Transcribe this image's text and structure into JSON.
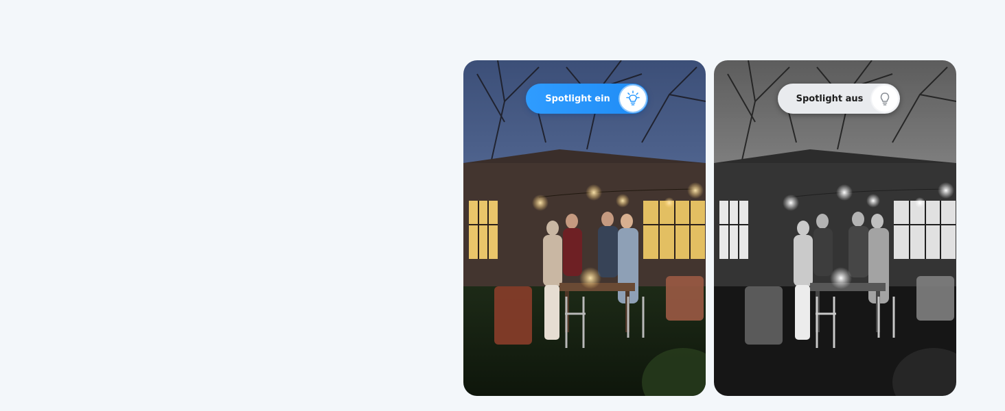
{
  "panels": [
    {
      "id": "spotlight-on",
      "toggle_label": "Spotlight ein",
      "icon": "lightbulb-on-icon",
      "state": "on",
      "image": "outdoor-dinner-party-color"
    },
    {
      "id": "spotlight-off",
      "toggle_label": "Spotlight aus",
      "icon": "lightbulb-off-icon",
      "state": "off",
      "image": "outdoor-dinner-party-grayscale"
    }
  ],
  "colors": {
    "background": "#f3f7fa",
    "toggle_on": "#2f9cff",
    "toggle_off": "#e9ebee",
    "bulb_on": "#2f9cff",
    "bulb_off": "#8a8f96"
  }
}
